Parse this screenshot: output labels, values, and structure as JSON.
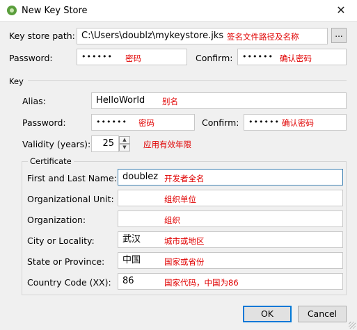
{
  "window": {
    "title": "New Key Store",
    "close_symbol": "✕"
  },
  "keystore": {
    "path_label": "Key store path:",
    "path_value": "C:\\Users\\doublz\\mykeystore.jks",
    "path_note": "签名文件路径及名称",
    "browse_label": "...",
    "password_label": "Password:",
    "password_value": "••••••",
    "password_note": "密码",
    "confirm_label": "Confirm:",
    "confirm_value": "••••••",
    "confirm_note": "确认密码"
  },
  "key": {
    "group_label": "Key",
    "alias_label": "Alias:",
    "alias_value": "HelloWorld",
    "alias_note": "别名",
    "password_label": "Password:",
    "password_value": "••••••",
    "password_note": "密码",
    "confirm_label": "Confirm:",
    "confirm_value": "••••••",
    "confirm_note": "确认密码",
    "validity_label": "Validity (years):",
    "validity_value": "25",
    "validity_note": "应用有效年限"
  },
  "certificate": {
    "group_label": "Certificate",
    "fields": [
      {
        "label": "First and Last Name:",
        "value": "doublez",
        "note": "开发者全名"
      },
      {
        "label": "Organizational Unit:",
        "value": "",
        "note": "组织单位"
      },
      {
        "label": "Organization:",
        "value": "",
        "note": "组织"
      },
      {
        "label": "City or Locality:",
        "value": "武汉",
        "note": "城市或地区"
      },
      {
        "label": "State or Province:",
        "value": "中国",
        "note": "国家或省份"
      },
      {
        "label": "Country Code (XX):",
        "value": "86",
        "note": "国家代码，中国为86"
      }
    ]
  },
  "buttons": {
    "ok": "OK",
    "cancel": "Cancel"
  },
  "colors": {
    "note": "#e00000",
    "focus_border": "#3c7fb1",
    "default_button": "#0078d7"
  }
}
